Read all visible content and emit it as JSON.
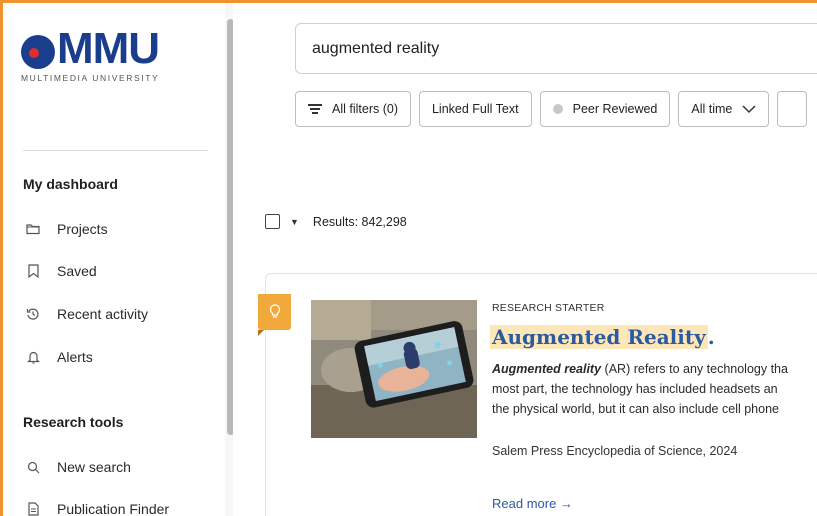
{
  "app": {
    "logo_text": "MMU",
    "logo_subtitle": "MULTIMEDIA UNIVERSITY",
    "colors": {
      "frame": "#f0922e",
      "brand_blue": "#1a3e8c",
      "link": "#2c5aa0",
      "highlight": "#fde7b8",
      "badge": "#f2a93b"
    }
  },
  "sidebar": {
    "dashboard_heading": "My dashboard",
    "dashboard_items": [
      {
        "label": "Projects",
        "icon": "folder-icon"
      },
      {
        "label": "Saved",
        "icon": "bookmark-icon"
      },
      {
        "label": "Recent activity",
        "icon": "history-icon"
      },
      {
        "label": "Alerts",
        "icon": "bell-icon"
      }
    ],
    "tools_heading": "Research tools",
    "tools_items": [
      {
        "label": "New search",
        "icon": "search-icon"
      },
      {
        "label": "Publication Finder",
        "icon": "document-icon"
      }
    ]
  },
  "search": {
    "query": "augmented reality"
  },
  "filters": {
    "all_filters": "All filters (0)",
    "linked_full_text": "Linked Full Text",
    "peer_reviewed": "Peer Reviewed",
    "time": "All time"
  },
  "results": {
    "count_label": "Results: 842,298"
  },
  "result_card": {
    "type_label": "RESEARCH STARTER",
    "title": "Augmented Reality",
    "title_suffix": ".",
    "abstract_lead": "Augmented reality",
    "abstract_line1": " (AR) refers to any technology tha",
    "abstract_line2": "most part, the technology has included headsets an",
    "abstract_line3": "the physical world, but it can also include cell phone",
    "source": "Salem Press Encyclopedia of Science, 2024",
    "read_more": "Read more →",
    "badge_icon": "lightbulb-icon"
  }
}
